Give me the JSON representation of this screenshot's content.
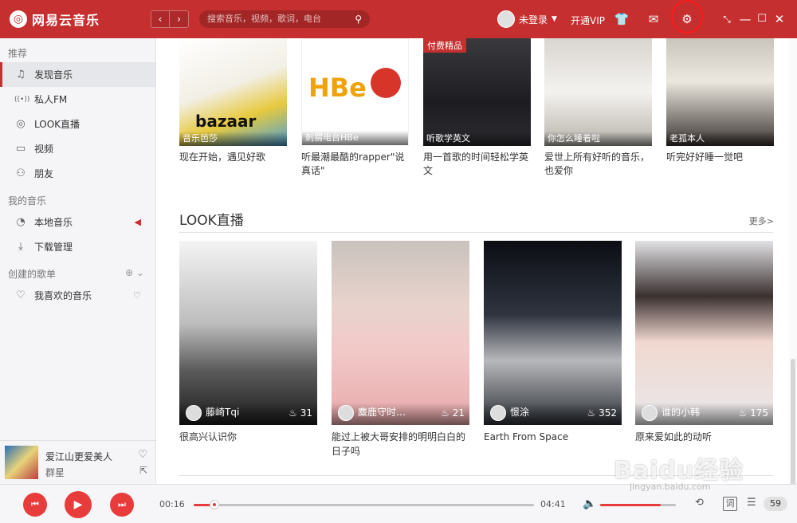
{
  "app": {
    "name": "网易云音乐",
    "accent": "#c62f2f"
  },
  "header": {
    "back_icon": "chevron-left-icon",
    "forward_icon": "chevron-right-icon",
    "search_placeholder": "搜索音乐，视频，歌词，电台",
    "user_label": "未登录",
    "vip_label": "开通VIP",
    "icons": [
      "skin-icon",
      "mail-icon",
      "settings-icon",
      "mini-mode-icon",
      "minimize-icon",
      "maximize-icon",
      "close-icon"
    ]
  },
  "sidebar": {
    "section1": "推荐",
    "items1": [
      {
        "label": "发现音乐",
        "icon": "♫",
        "active": true
      },
      {
        "label": "私人FM",
        "icon": "((•))"
      },
      {
        "label": "LOOK直播",
        "icon": "◎"
      },
      {
        "label": "视频",
        "icon": "▭"
      },
      {
        "label": "朋友",
        "icon": "⚇"
      }
    ],
    "section2": "我的音乐",
    "items2": [
      {
        "label": "本地音乐",
        "icon": "◔"
      },
      {
        "label": "下载管理",
        "icon": "⤓"
      }
    ],
    "section3": "创建的歌单",
    "items3": [
      {
        "label": "我喜欢的音乐",
        "icon": "♡"
      }
    ]
  },
  "now_playing": {
    "title": "爱江山更爱美人",
    "artist": "群星"
  },
  "playlists": [
    {
      "caption": "音乐芭莎",
      "title": "现在开始，遇见好歌",
      "badge": ""
    },
    {
      "caption": "刺猬电台HBe",
      "title": "听最潮最酷的rapper\"说真话\"",
      "badge": ""
    },
    {
      "caption": "听歌学英文",
      "title": "用一首歌的时间轻松学英文",
      "badge": "付费精品"
    },
    {
      "caption": "你怎么睡着啦",
      "title": "爱世上所有好听的音乐，也爱你",
      "badge": ""
    },
    {
      "caption": "老孤本人",
      "title": "听完好好睡一觉吧",
      "badge": ""
    }
  ],
  "look": {
    "title": "LOOK直播",
    "more": "更多>",
    "items": [
      {
        "name": "藤崎Tqi",
        "count": "31",
        "title": "很高兴认识你"
      },
      {
        "name": "麋鹿守时…",
        "count": "21",
        "title": "能过上被大哥安排的明明白白的日子吗"
      },
      {
        "name": "憬涂",
        "count": "352",
        "title": "Earth From Space"
      },
      {
        "name": "谁的小韩",
        "count": "175",
        "title": "原来爱如此的动听"
      }
    ]
  },
  "player": {
    "current": "00:16",
    "total": "04:41",
    "progress": 0.06,
    "volume": 0.8,
    "lyric": "词",
    "playlist_count": "59"
  },
  "watermark": {
    "text": "Baidu经验",
    "url": "jingyan.baidu.com"
  }
}
